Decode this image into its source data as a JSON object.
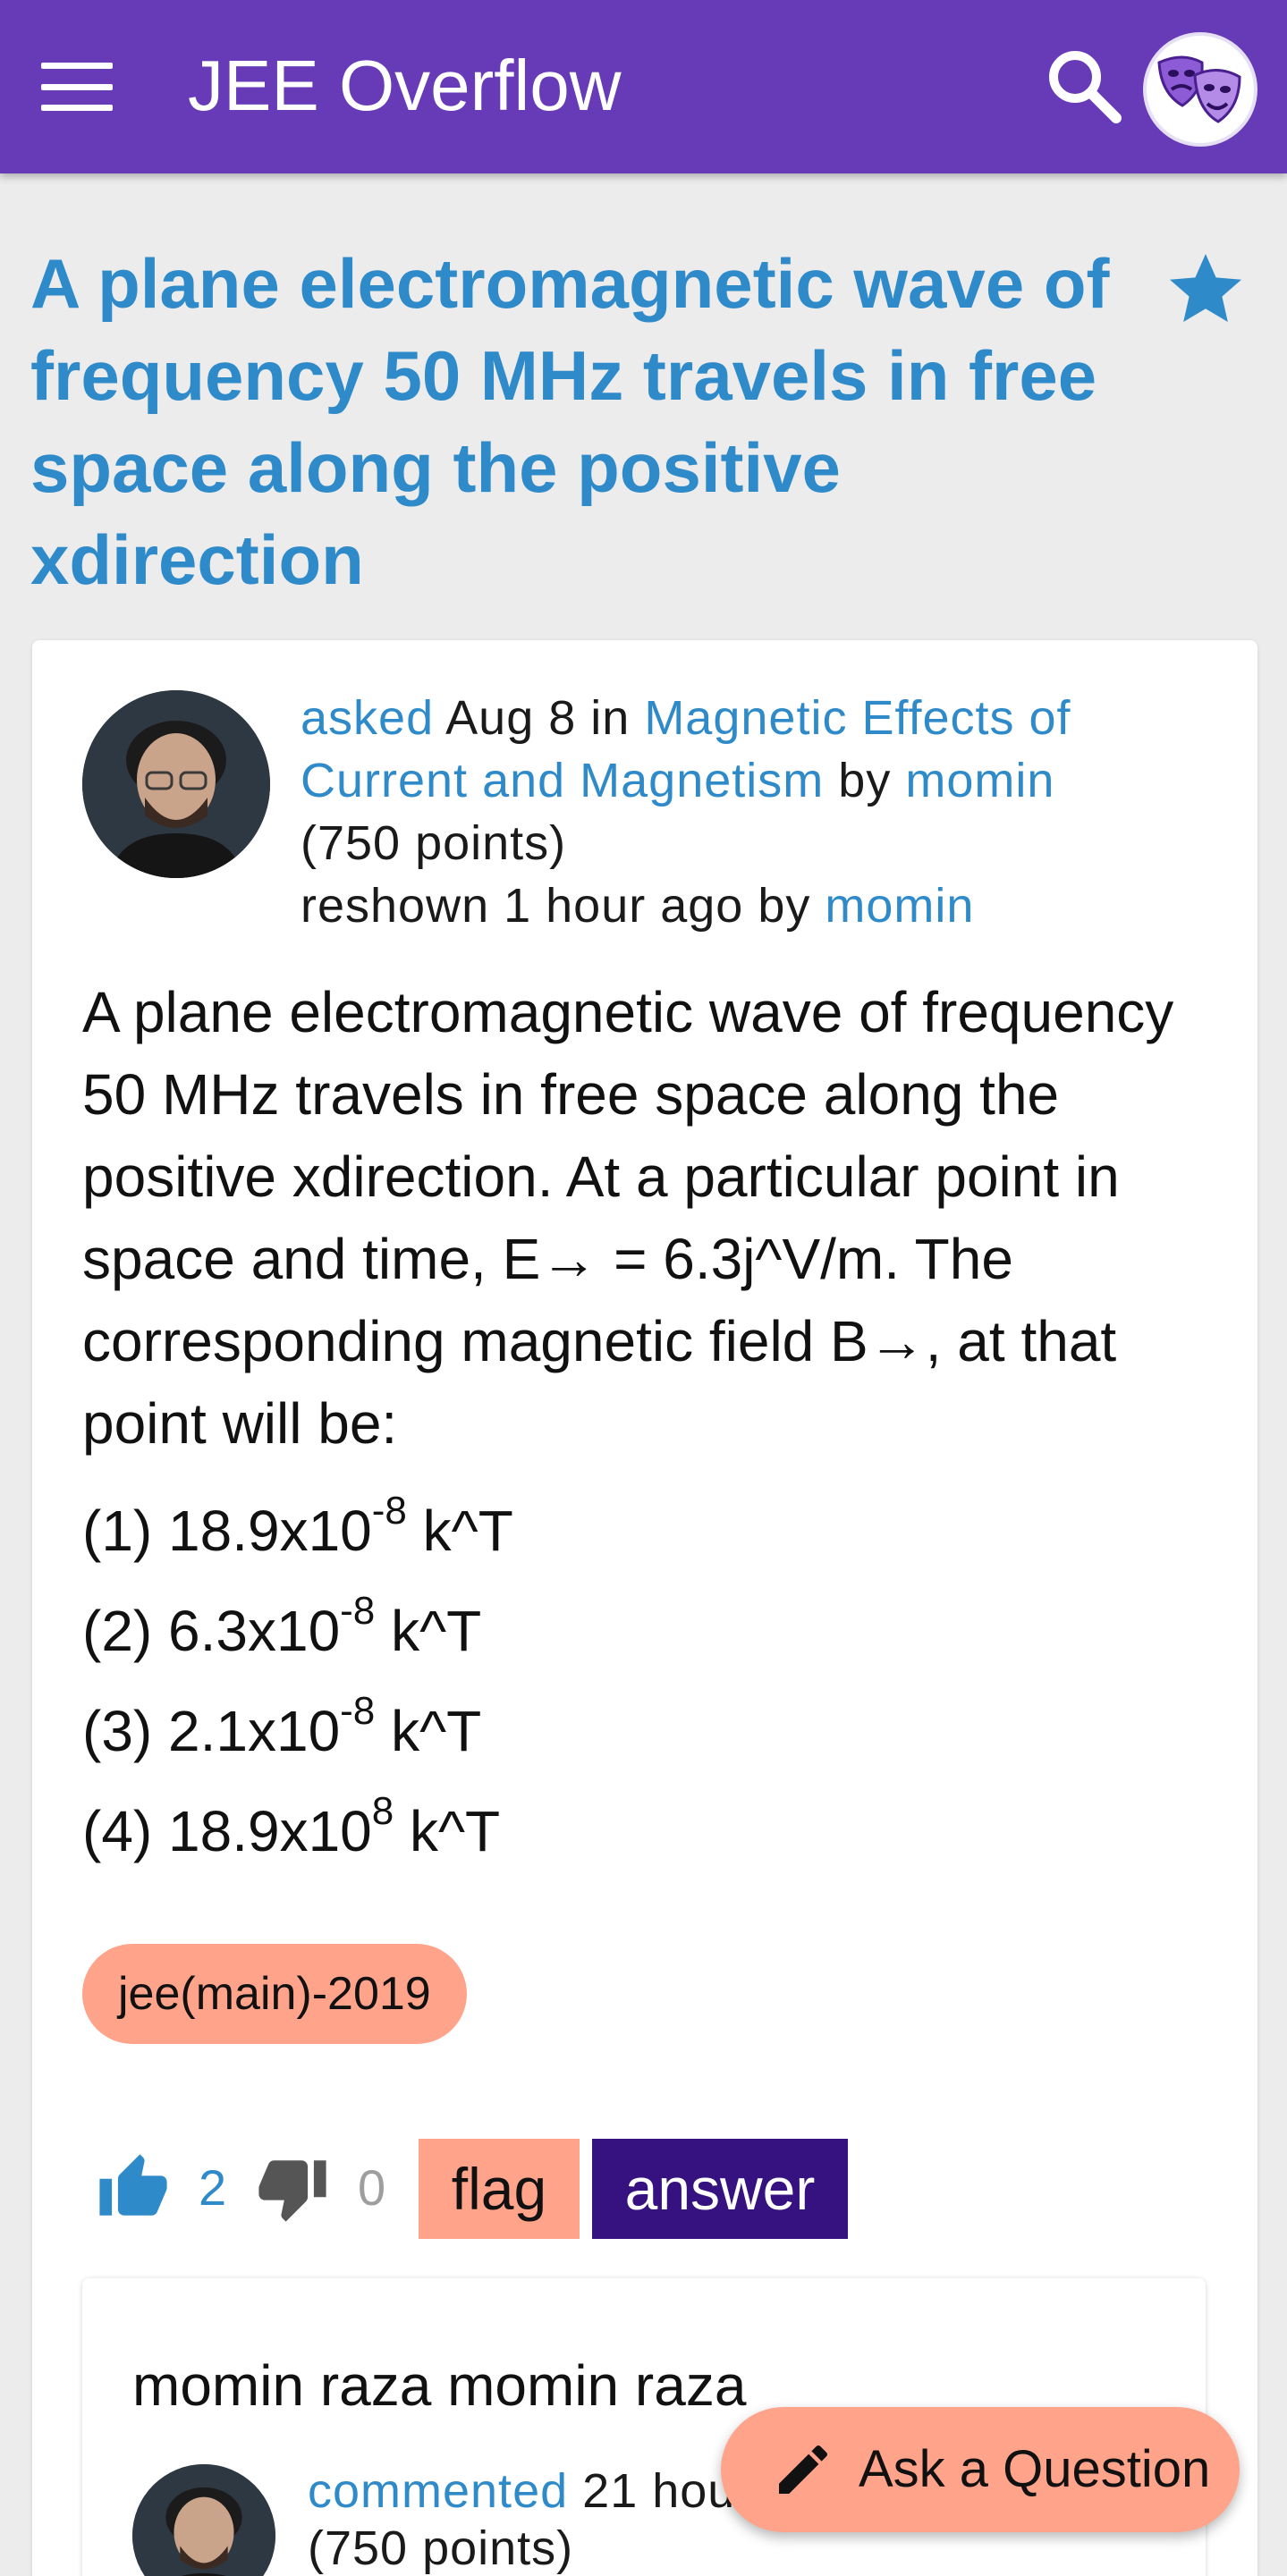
{
  "appbar": {
    "title": "JEE Overflow",
    "menu_icon": "hamburger-menu-icon",
    "search_icon": "search-icon",
    "avatar_icon": "theater-masks-avatar"
  },
  "question": {
    "title": "A plane electromagnetic wave of frequency 50 MHz travels in free space along the positive xdirection",
    "favorite_icon": "star-icon",
    "asked_word": "asked",
    "date": "Aug 8",
    "in_word": "in",
    "category": "Magnetic Effects of Current and Magnetism",
    "by_word": "by",
    "author": "momin",
    "author_points": "(750 points)",
    "reshown_text": "reshown 1 hour ago by",
    "reshown_by": "momin",
    "body": "A plane electromagnetic wave of frequency 50 MHz travels in free space along the positive xdirection. At a particular point in space and time, E→ = 6.3j^V/m. The corresponding magnetic field B→, at that point will be:",
    "options": [
      {
        "prefix": "(1) 18.9x10",
        "exp": "-8",
        "suffix": " k^T"
      },
      {
        "prefix": "(2) 6.3x10",
        "exp": "-8",
        "suffix": " k^T"
      },
      {
        "prefix": "(3) 2.1x10",
        "exp": "-8",
        "suffix": " k^T"
      },
      {
        "prefix": "(4) 18.9x10",
        "exp": "8",
        "suffix": " k^T"
      }
    ],
    "tag": "jee(main)-2019"
  },
  "votes": {
    "up_icon": "thumbs-up-icon",
    "up_count": "2",
    "down_icon": "thumbs-down-icon",
    "down_count": "0",
    "flag_label": "flag",
    "answer_label": "answer"
  },
  "comment": {
    "title": "momin raza momin raza",
    "action": "commented",
    "time": "21 hou",
    "points": "(750 points)"
  },
  "fab": {
    "label": "Ask a Question",
    "icon": "pencil-icon"
  },
  "colors": {
    "appbar": "#673ab7",
    "link": "#2f8ac9",
    "accent": "#ffa38b",
    "answer": "#35127f",
    "background": "#ececec"
  }
}
